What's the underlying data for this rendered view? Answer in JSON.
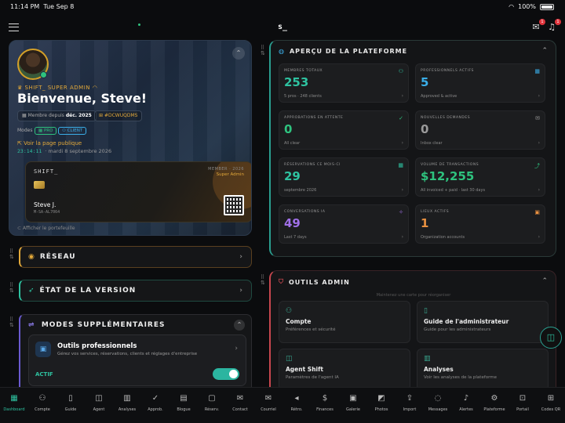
{
  "status_bar": {
    "time": "11:14 PM",
    "date": "Tue Sep 8",
    "battery": "100%"
  },
  "header": {
    "logo": "s_",
    "mail_badge": "1",
    "bell_badge": "1"
  },
  "profile": {
    "role": "SHIFT_ SUPER ADMIN",
    "welcome": "Bienvenue, Steve!",
    "member_since_label": "Membre depuis",
    "member_since_value": "déc. 2025",
    "member_code": "#DCWUQDMS",
    "modes_label": "Modes",
    "modes": [
      "PRO",
      "CLIENT"
    ],
    "public_link": "Voir la page publique",
    "clock": "23:14:11",
    "clock_date": "· mardi 8 septembre 2026",
    "card": {
      "brand": "SHIFT_",
      "member_year": "MEMBER · 2026",
      "level": "Super Admin",
      "holder": "Steve J.",
      "id": "M-SA-AL7064"
    },
    "wallet_link": "Afficher le portefeuille"
  },
  "accordions": {
    "network": "RÉSEAU",
    "version": "ÉTAT DE LA VERSION",
    "modes": "MODES SUPPLÉMENTAIRES"
  },
  "pro_tools": {
    "title": "Outils professionnels",
    "desc": "Gérez vos services, réservations, clients et réglages d'entreprise",
    "status": "ACTIF",
    "enabled": true
  },
  "overview": {
    "title": "APERÇU DE LA PLATEFORME",
    "stats": [
      {
        "label": "MEMBRES TOTAUX",
        "value": "253",
        "sub": "5 pros · 248 clients",
        "color": "#2ec2a0"
      },
      {
        "label": "PROFESSIONNELS ACTIFS",
        "value": "5",
        "sub": "Approved & active",
        "color": "#3aaee8"
      },
      {
        "label": "APPROBATIONS EN ATTENTE",
        "value": "0",
        "sub": "All clear",
        "color": "#2ec27e"
      },
      {
        "label": "NOUVELLES DEMANDES",
        "value": "0",
        "sub": "Inbox clear",
        "color": "#9a9a9a"
      },
      {
        "label": "RÉSERVATIONS CE MOIS-CI",
        "value": "29",
        "sub": "septembre 2026",
        "color": "#2ec2a0"
      },
      {
        "label": "VOLUME DE TRANSACTIONS",
        "value": "$12,255",
        "sub": "All invoiced + paid · last 30 days",
        "color": "#2ec27e"
      },
      {
        "label": "CONVERSATIONS IA",
        "value": "49",
        "sub": "Last 7 days",
        "color": "#a070e8"
      },
      {
        "label": "LIEUX ACTIFS",
        "value": "1",
        "sub": "Organization accounts",
        "color": "#e89040"
      }
    ]
  },
  "admin_tools": {
    "title": "OUTILS ADMIN",
    "hint": "Maintenez une carte pour réorganiser",
    "tiles": [
      {
        "title": "Compte",
        "sub": "Préférences et sécurité"
      },
      {
        "title": "Guide de l'administrateur",
        "sub": "Guide pour les administrateurs"
      },
      {
        "title": "Agent Shift",
        "sub": "Paramètres de l'agent IA"
      },
      {
        "title": "Analyses",
        "sub": "Voir les analyses de la plateforme"
      }
    ]
  },
  "nav": [
    {
      "label": "Dashboard",
      "icon": "▦"
    },
    {
      "label": "Compte",
      "icon": "⚇"
    },
    {
      "label": "Guide",
      "icon": "▯"
    },
    {
      "label": "Agent",
      "icon": "◫"
    },
    {
      "label": "Analyses",
      "icon": "▥"
    },
    {
      "label": "Approb.",
      "icon": "✓"
    },
    {
      "label": "Blogue",
      "icon": "▤"
    },
    {
      "label": "Réserv.",
      "icon": "▢"
    },
    {
      "label": "Contact",
      "icon": "✉"
    },
    {
      "label": "Courriel",
      "icon": "✉"
    },
    {
      "label": "Rétro.",
      "icon": "◂"
    },
    {
      "label": "Finances",
      "icon": "$"
    },
    {
      "label": "Galerie",
      "icon": "▣"
    },
    {
      "label": "Photos",
      "icon": "◩"
    },
    {
      "label": "Import",
      "icon": "⇪"
    },
    {
      "label": "Messages",
      "icon": "◌"
    },
    {
      "label": "Alertes",
      "icon": "♪"
    },
    {
      "label": "Plateforme",
      "icon": "⚙"
    },
    {
      "label": "Portail",
      "icon": "⊡"
    },
    {
      "label": "Codes QR",
      "icon": "⊞"
    }
  ]
}
